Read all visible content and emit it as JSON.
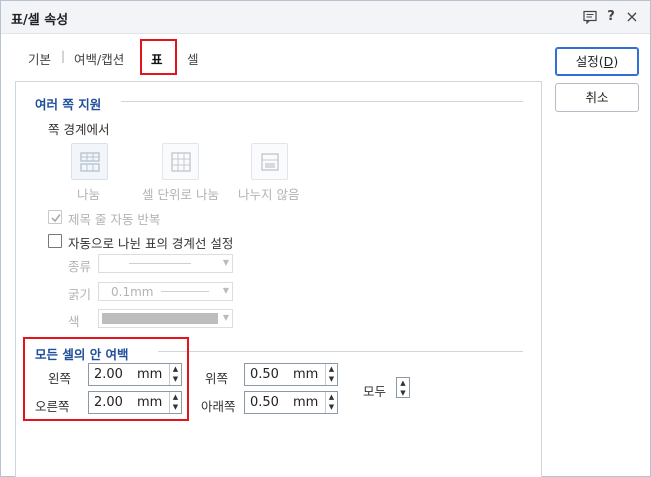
{
  "window": {
    "title": "표/셀 속성",
    "help_label": "?",
    "close_label": "×"
  },
  "tabs": [
    {
      "label": "기본"
    },
    {
      "label": "여백/캡션"
    },
    {
      "label": "표"
    },
    {
      "label": "셀"
    }
  ],
  "tab_separator": "|",
  "buttons": {
    "ok_label": "설정(",
    "ok_key": "D",
    "ok_suffix": ")",
    "cancel_label": "취소"
  },
  "multi_page": {
    "title": "여러 쪽 지원",
    "subtitle": "쪽 경계에서",
    "options": [
      {
        "label": "나눔",
        "icon": "table-split-icon"
      },
      {
        "label": "셀 단위로 나눔",
        "icon": "table-cell-split-icon"
      },
      {
        "label": "나누지 않음",
        "icon": "table-no-split-icon"
      }
    ],
    "repeat_header_label": "제목 줄 자동 반복",
    "repeat_header_checked": true,
    "auto_border_label": "자동으로 나뉜 표의 경계선 설정",
    "auto_border_checked": false,
    "line_type_label": "종류",
    "line_width_label": "굵기",
    "line_width_value": "0.1mm",
    "line_color_label": "색"
  },
  "cell_margin": {
    "title": "모든 셀의 안 여백",
    "left_label": "왼쪽",
    "left_value": "2.00",
    "right_label": "오른쪽",
    "right_value": "2.00",
    "top_label": "위쪽",
    "top_value": "0.50",
    "bottom_label": "아래쪽",
    "bottom_value": "0.50",
    "all_label": "모두",
    "unit": "mm"
  },
  "colors": {
    "highlight": "#e3141b",
    "section_title": "#1f4e9a",
    "primary_border": "#2f6fd6"
  }
}
